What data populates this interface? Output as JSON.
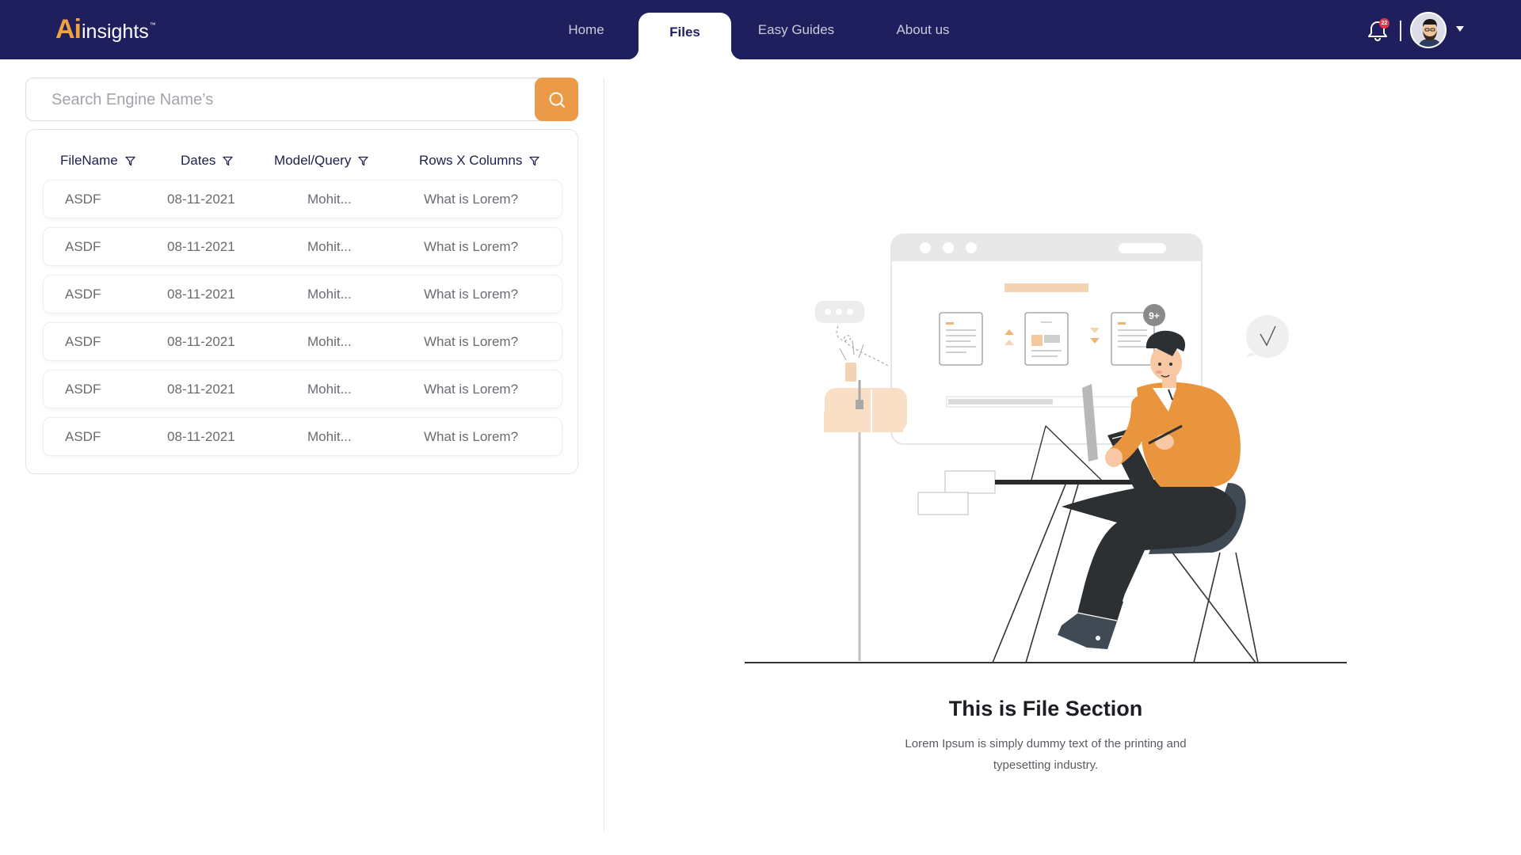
{
  "app": {
    "logo_ai": "Ai",
    "logo_insights": "insights",
    "logo_tm": "™"
  },
  "nav": {
    "items": [
      {
        "label": "Home",
        "active": false
      },
      {
        "label": "Files",
        "active": true
      },
      {
        "label": "Easy Guides",
        "active": false
      },
      {
        "label": "About us",
        "active": false
      }
    ]
  },
  "header": {
    "notification_count": "22",
    "icons": {
      "bell": "bell-icon",
      "avatar": "user-avatar",
      "dropdown": "caret-down-icon"
    }
  },
  "search": {
    "placeholder": "Search Engine Name’s",
    "value": "",
    "icon": "search-icon"
  },
  "table": {
    "columns": [
      {
        "label": "FileName",
        "icon": "filter-icon"
      },
      {
        "label": "Dates",
        "icon": "filter-icon"
      },
      {
        "label": "Model/Query",
        "icon": "filter-icon"
      },
      {
        "label": "Rows X Columns",
        "icon": "filter-icon"
      }
    ],
    "rows": [
      [
        "ASDF",
        "08-11-2021",
        "Mohit...",
        "What is Lorem?"
      ],
      [
        "ASDF",
        "08-11-2021",
        "Mohit...",
        "What is Lorem?"
      ],
      [
        "ASDF",
        "08-11-2021",
        "Mohit...",
        "What is Lorem?"
      ],
      [
        "ASDF",
        "08-11-2021",
        "Mohit...",
        "What is Lorem?"
      ],
      [
        "ASDF",
        "08-11-2021",
        "Mohit...",
        "What is Lorem?"
      ],
      [
        "ASDF",
        "08-11-2021",
        "Mohit...",
        "What is Lorem?"
      ]
    ]
  },
  "empty_state": {
    "title": "This is File Section",
    "description": "Lorem Ipsum is simply dummy text of the printing and typesetting industry.",
    "illustration_badge": "9+"
  },
  "colors": {
    "header_bg": "#1e1f5c",
    "accent": "#eb9a48",
    "badge": "#e8344a"
  }
}
